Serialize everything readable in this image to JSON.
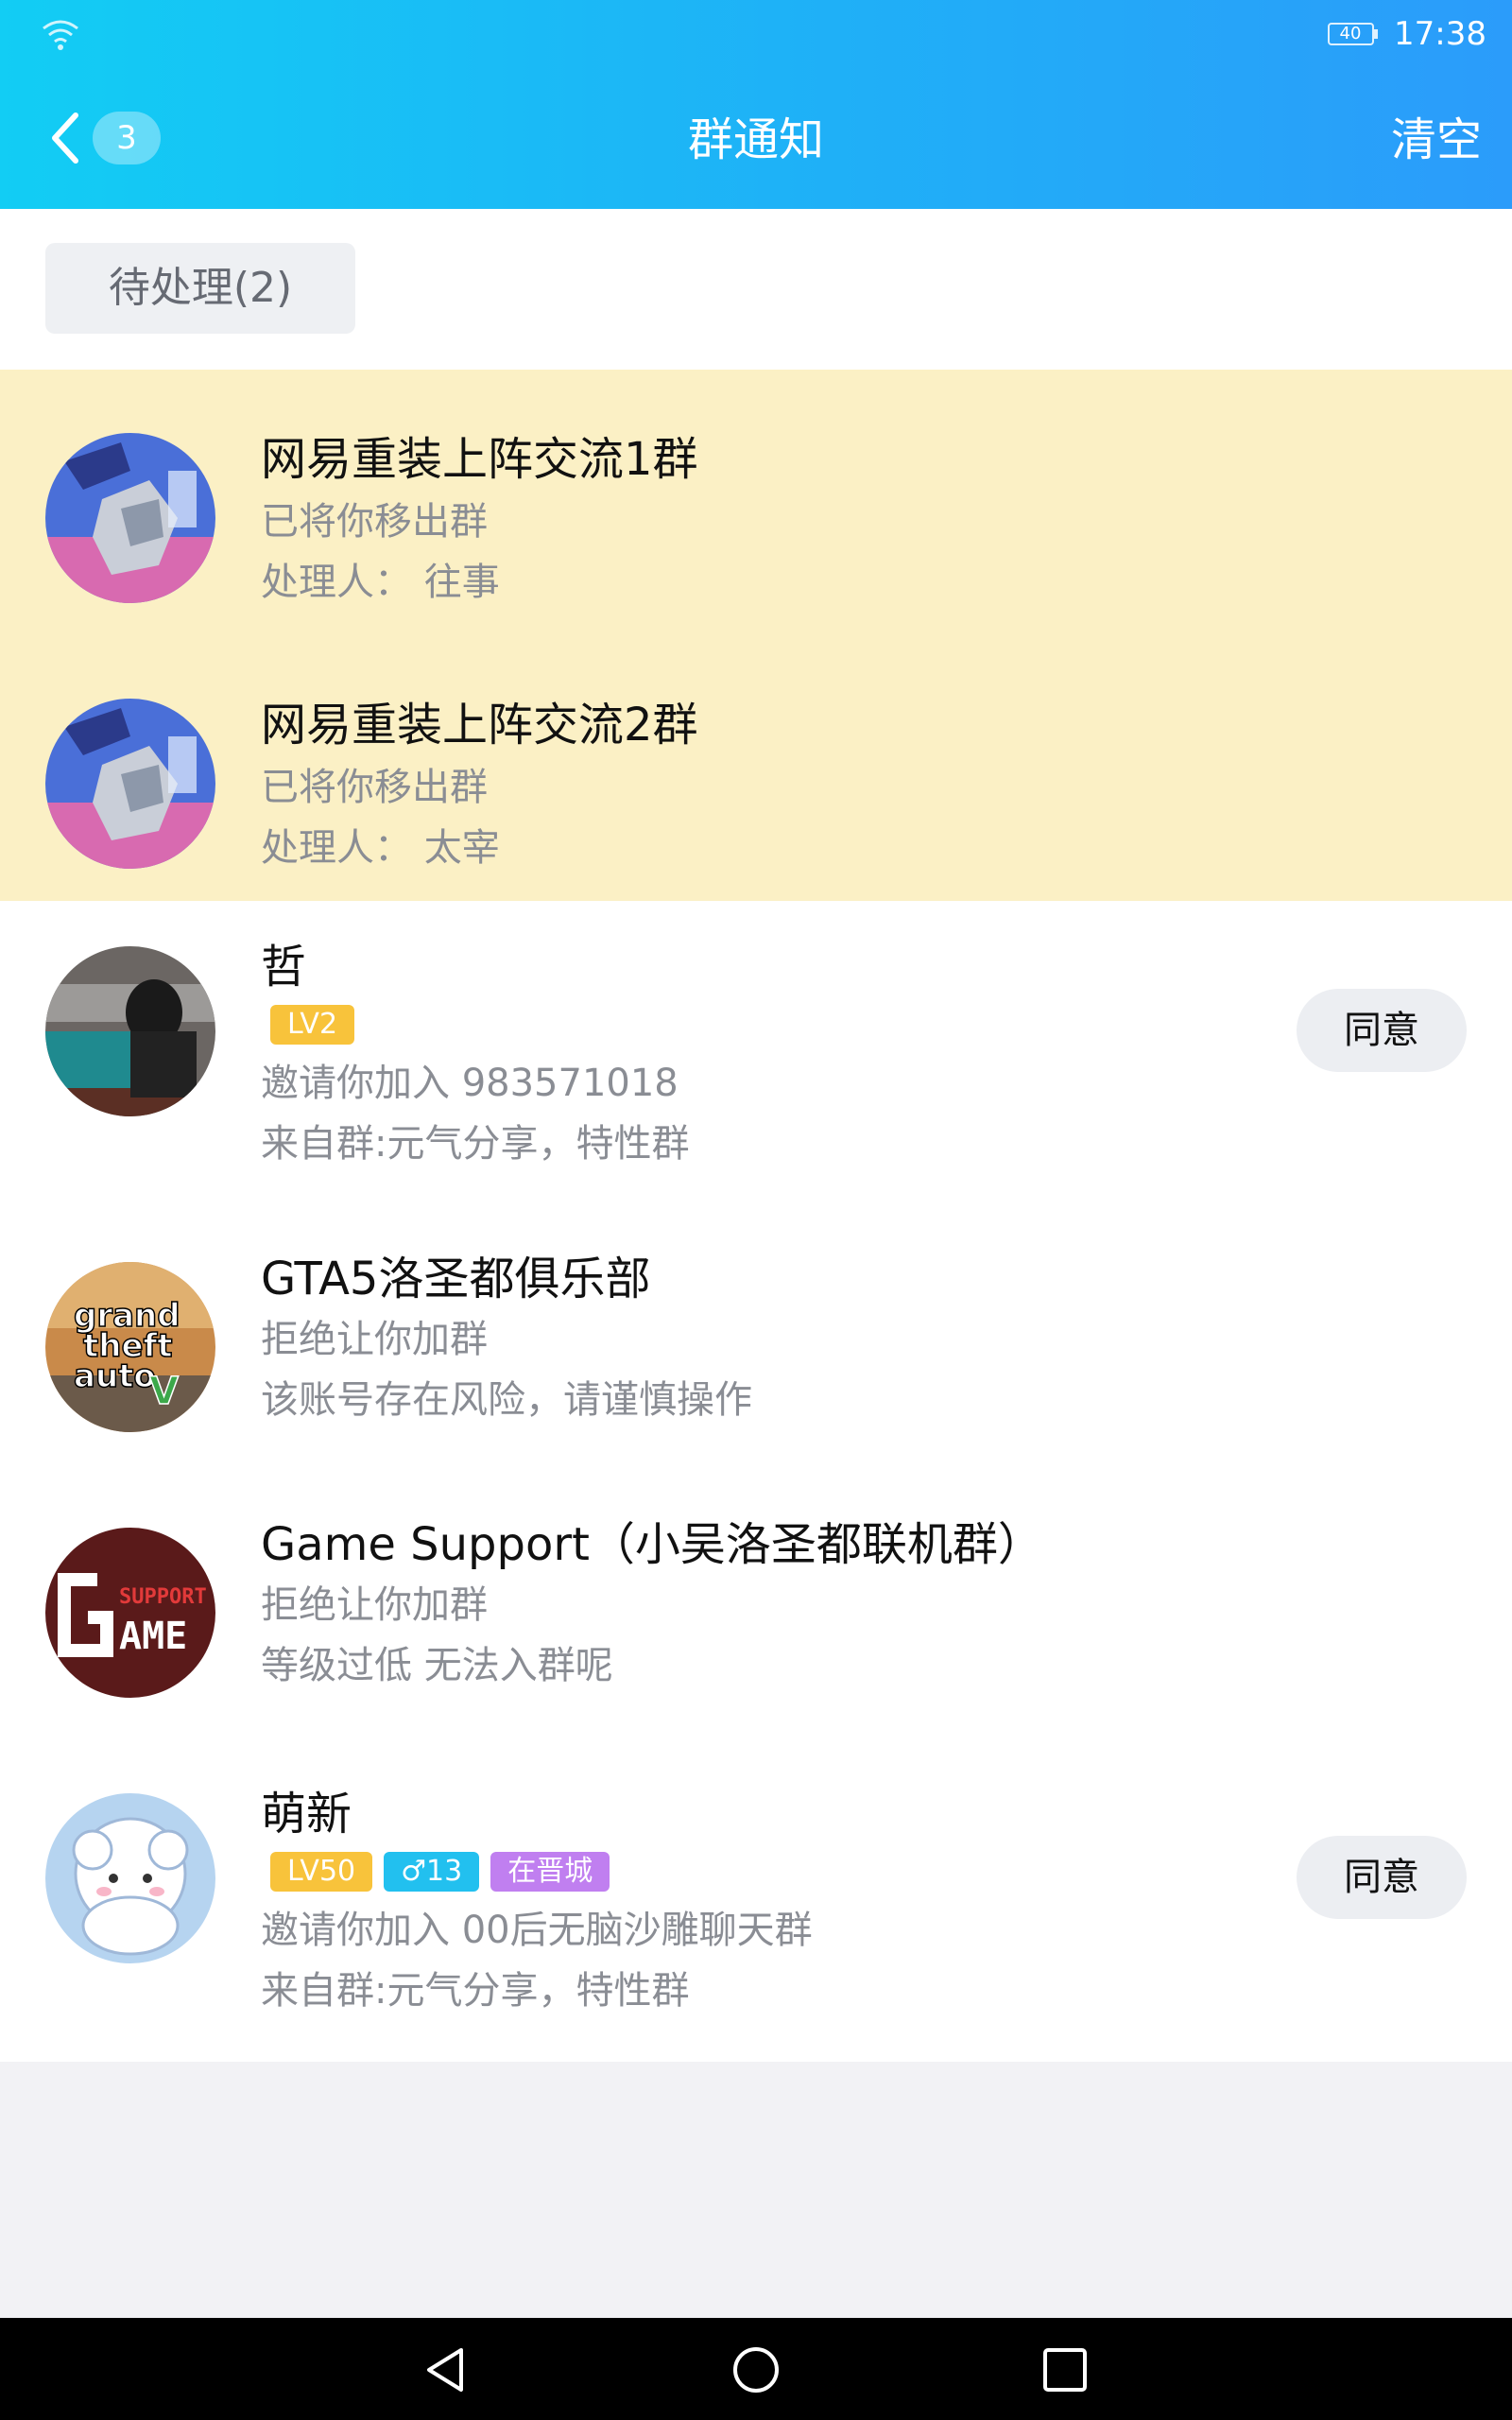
{
  "status_bar": {
    "battery": "40",
    "time": "17:38"
  },
  "header": {
    "unread_count": "3",
    "title": "群通知",
    "clear_label": "清空"
  },
  "filter": {
    "pending_label": "待处理(2)"
  },
  "notifications": [
    {
      "title": "网易重装上阵交流1群",
      "line1": "已将你移出群",
      "line2": "处理人： 往事",
      "avatar_icon": "mech-robot-avatar"
    },
    {
      "title": "网易重装上阵交流2群",
      "line1": "已将你移出群",
      "line2": "处理人： 太宰",
      "avatar_icon": "mech-robot-avatar"
    },
    {
      "title": "哲",
      "tags": [
        "LV2"
      ],
      "line1": "邀请你加入 983571018",
      "line2": "来自群:元气分享，特性群",
      "button": "同意",
      "avatar_icon": "billiards-photo-avatar"
    },
    {
      "title": "GTA5洛圣都俱乐部",
      "line1": "拒绝让你加群",
      "line2": "该账号存在风险，请谨慎操作",
      "avatar_icon": "gta-logo-avatar",
      "avatar_text": [
        "grand",
        "theft",
        "auto",
        "V"
      ]
    },
    {
      "title": "Game Support（小吴洛圣都联机群）",
      "line1": "拒绝让你加群",
      "line2": "等级过低 无法入群呢",
      "avatar_icon": "game-support-avatar",
      "avatar_text": [
        "SUPPORT",
        "AME"
      ]
    },
    {
      "title": "萌新",
      "tags": [
        "LV50",
        "♂13",
        "在晋城"
      ],
      "line1": "邀请你加入 00后无脑沙雕聊天群",
      "line2": "来自群:元气分享，特性群",
      "button": "同意",
      "avatar_icon": "sheep-cartoon-avatar"
    }
  ],
  "colors": {
    "header_start": "#12cdf4",
    "header_end": "#2b9cfa",
    "highlight": "#fbf0c5",
    "tag_level": "#f8c33b",
    "tag_gender": "#22c0ef",
    "tag_location": "#c07ff0"
  }
}
